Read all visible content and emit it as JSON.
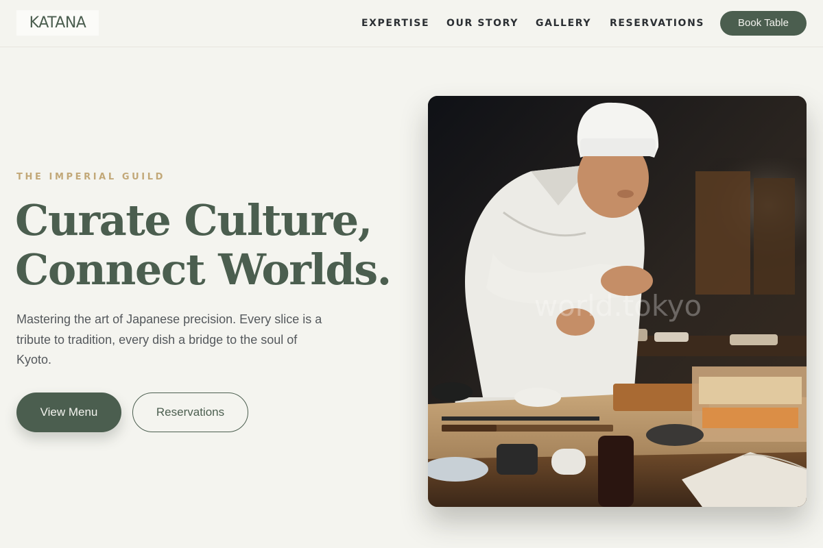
{
  "brand": {
    "logo": "KATANA"
  },
  "nav": {
    "items": [
      {
        "label": "EXPERTISE"
      },
      {
        "label": "OUR STORY"
      },
      {
        "label": "GALLERY"
      },
      {
        "label": "RESERVATIONS"
      }
    ],
    "cta_label": "Book Table"
  },
  "hero": {
    "eyebrow": "THE IMPERIAL GUILD",
    "headline_line1": "Curate Culture,",
    "headline_line2": "Connect Worlds.",
    "subtext": "Mastering the art of Japanese precision. Every slice is a tribute to tradition, every dish a bridge to the soul of Kyoto.",
    "primary_button": "View Menu",
    "secondary_button": "Reservations",
    "image_watermark": "world.tokyo"
  },
  "colors": {
    "background": "#f4f4ef",
    "brand_green": "#4b5e4f",
    "eyebrow_gold": "#c2a878",
    "text_dark": "#2b2f33"
  }
}
